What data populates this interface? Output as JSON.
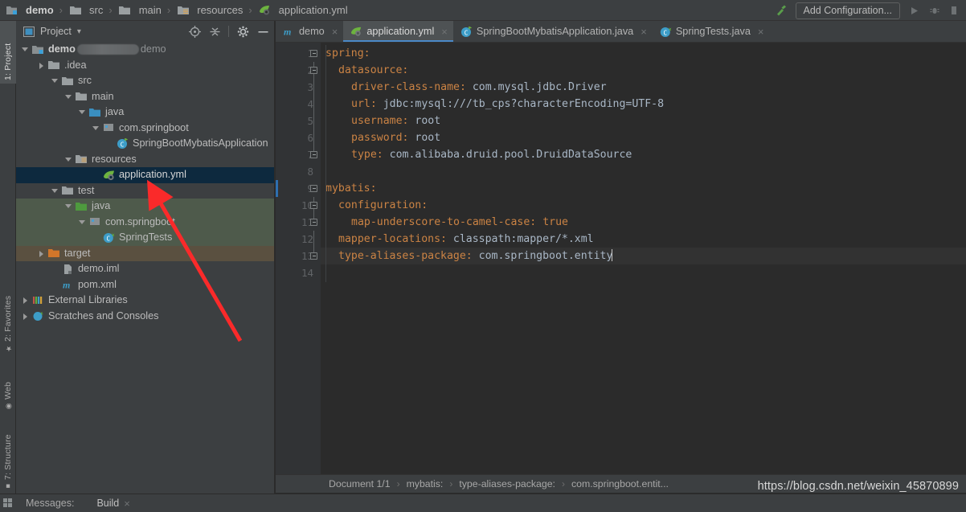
{
  "breadcrumb": {
    "items": [
      {
        "label": "demo",
        "icon": "module-icon",
        "bold": true
      },
      {
        "label": "src",
        "icon": "folder-icon",
        "bold": false
      },
      {
        "label": "main",
        "icon": "folder-icon",
        "bold": false
      },
      {
        "label": "resources",
        "icon": "resources-folder-icon",
        "bold": false
      },
      {
        "label": "application.yml",
        "icon": "spring-yaml-icon",
        "bold": false
      }
    ],
    "separator": "›"
  },
  "toolbar": {
    "build_icon": "hammer-icon",
    "run_config_label": "Add Configuration...",
    "run_icon": "run-icon",
    "debug_icon": "debug-icon",
    "accent_color": "#4a88c7"
  },
  "left_strip": {
    "tabs": [
      {
        "label": "1: Project",
        "icon": "project-icon",
        "active": true
      },
      {
        "label": "2: Favorites",
        "icon": "star-icon",
        "active": false
      },
      {
        "label": "Web",
        "icon": "web-icon",
        "active": false
      },
      {
        "label": "7: Structure",
        "icon": "structure-icon",
        "active": false
      }
    ]
  },
  "project_panel": {
    "title": "Project",
    "chevron": "▾",
    "icons": [
      {
        "name": "locate-target-icon"
      },
      {
        "name": "collapse-all-icon"
      },
      {
        "name": "settings-gear-icon"
      },
      {
        "name": "hide-panel-icon"
      }
    ],
    "tree": [
      {
        "indent": 0,
        "arrow": "down",
        "icon": "module-icon",
        "label": "demo",
        "bold": true,
        "suffix": "demo",
        "redacted": true,
        "state": "normal"
      },
      {
        "indent": 1,
        "arrow": "right",
        "icon": "folder-icon",
        "label": ".idea",
        "state": "normal"
      },
      {
        "indent": 1,
        "arrow": "down",
        "icon": "folder-icon",
        "label": "src",
        "state": "normal"
      },
      {
        "indent": 2,
        "arrow": "down",
        "icon": "folder-icon",
        "label": "main",
        "state": "normal"
      },
      {
        "indent": 3,
        "arrow": "down",
        "icon": "source-folder-icon",
        "label": "java",
        "state": "normal"
      },
      {
        "indent": 4,
        "arrow": "down",
        "icon": "package-icon",
        "label": "com.springboot",
        "state": "normal"
      },
      {
        "indent": 5,
        "arrow": "none",
        "icon": "spring-class-icon",
        "label": "SpringBootMybatisApplication",
        "state": "normal"
      },
      {
        "indent": 3,
        "arrow": "down",
        "icon": "resources-folder-icon",
        "label": "resources",
        "state": "normal"
      },
      {
        "indent": 4,
        "arrow": "none",
        "icon": "spring-yaml-icon",
        "label": "application.yml",
        "state": "selected"
      },
      {
        "indent": 2,
        "arrow": "down",
        "icon": "folder-icon",
        "label": "test",
        "state": "normal"
      },
      {
        "indent": 3,
        "arrow": "down",
        "icon": "test-source-folder-icon",
        "label": "java",
        "state": "test"
      },
      {
        "indent": 4,
        "arrow": "down",
        "icon": "package-icon",
        "label": "com.springboot",
        "state": "test"
      },
      {
        "indent": 5,
        "arrow": "none",
        "icon": "test-class-icon",
        "label": "SpringTests",
        "state": "test"
      },
      {
        "indent": 1,
        "arrow": "right",
        "icon": "excluded-folder-icon",
        "label": "target",
        "state": "excluded"
      },
      {
        "indent": 2,
        "arrow": "none",
        "icon": "iml-file-icon",
        "label": "demo.iml",
        "state": "normal"
      },
      {
        "indent": 2,
        "arrow": "none",
        "icon": "maven-pom-icon",
        "label": "pom.xml",
        "state": "normal"
      },
      {
        "indent": 0,
        "arrow": "right",
        "icon": "external-libraries-icon",
        "label": "External Libraries",
        "state": "normal"
      },
      {
        "indent": 0,
        "arrow": "right",
        "icon": "scratches-icon",
        "label": "Scratches and Consoles",
        "state": "normal"
      }
    ]
  },
  "editor": {
    "tabs": [
      {
        "label": "demo",
        "icon": "maven-pom-icon",
        "active": false,
        "close": "×"
      },
      {
        "label": "application.yml",
        "icon": "spring-yaml-icon",
        "active": true,
        "close": "×"
      },
      {
        "label": "SpringBootMybatisApplication.java",
        "icon": "spring-class-icon",
        "active": false,
        "close": "×"
      },
      {
        "label": "SpringTests.java",
        "icon": "test-class-icon",
        "active": false,
        "close": "×"
      }
    ],
    "line_numbers": [
      "1",
      "2",
      "3",
      "4",
      "5",
      "6",
      "7",
      "8",
      "9",
      "10",
      "11",
      "12",
      "13",
      "14"
    ],
    "lines": [
      {
        "n": 1,
        "indent": 0,
        "key": "spring:",
        "value": "",
        "current": false
      },
      {
        "n": 2,
        "indent": 2,
        "key": "datasource:",
        "value": "",
        "current": false
      },
      {
        "n": 3,
        "indent": 4,
        "key": "driver-class-name:",
        "value": " com.mysql.jdbc.Driver",
        "current": false
      },
      {
        "n": 4,
        "indent": 4,
        "key": "url:",
        "value": " jdbc:mysql:///tb_cps?characterEncoding=UTF-8",
        "current": false
      },
      {
        "n": 5,
        "indent": 4,
        "key": "username:",
        "value": " root",
        "current": false
      },
      {
        "n": 6,
        "indent": 4,
        "key": "password:",
        "value": " root",
        "current": false
      },
      {
        "n": 7,
        "indent": 4,
        "key": "type:",
        "value": " com.alibaba.druid.pool.DruidDataSource",
        "current": false
      },
      {
        "n": 8,
        "indent": 0,
        "key": "",
        "value": "",
        "current": false
      },
      {
        "n": 9,
        "indent": 0,
        "key": "mybatis:",
        "value": "",
        "current": false
      },
      {
        "n": 10,
        "indent": 2,
        "key": "configuration:",
        "value": "",
        "current": false
      },
      {
        "n": 11,
        "indent": 4,
        "key": "map-underscore-to-camel-case:",
        "value": " true",
        "value_kind": "boolean",
        "current": false
      },
      {
        "n": 12,
        "indent": 2,
        "key": "mapper-locations:",
        "value": " classpath:mapper/*.xml",
        "current": false
      },
      {
        "n": 13,
        "indent": 2,
        "key": "type-aliases-package:",
        "value": " com.springboot.entity",
        "caret": true,
        "current": true
      },
      {
        "n": 14,
        "indent": 0,
        "key": "",
        "value": "",
        "current": false
      }
    ],
    "syntax_colors": {
      "key": "#cb8344",
      "value": "#a9b7c6",
      "line_number": "#606366",
      "background": "#2b2b2b"
    },
    "status_breadcrumb": {
      "items": [
        "Document 1/1",
        "mybatis:",
        "type-aliases-package:",
        "com.springboot.entit..."
      ],
      "separator": "›"
    }
  },
  "bottom_bar": {
    "messages_label": "Messages:",
    "build_tab": "Build",
    "build_close": "×"
  },
  "watermark": {
    "text": "https://blog.csdn.net/weixin_45870899"
  },
  "annotation": {
    "type": "red-arrow",
    "color": "#fa2a2a"
  }
}
